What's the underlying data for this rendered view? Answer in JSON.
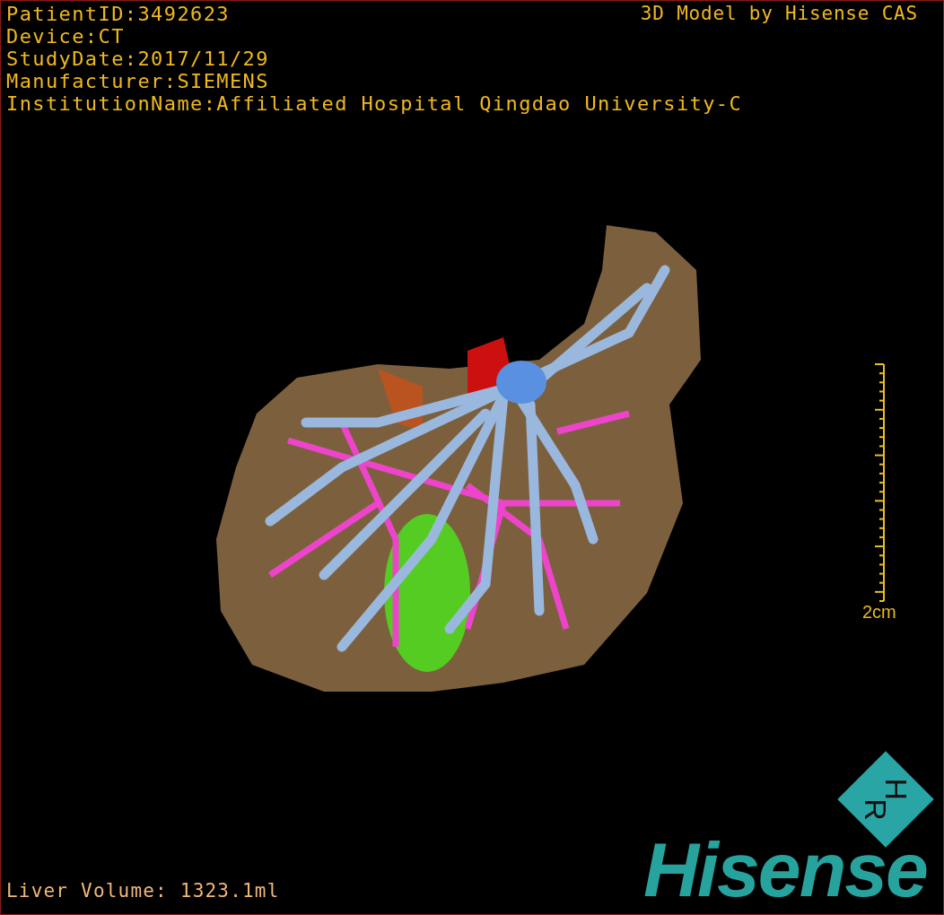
{
  "info_lines": [
    "PatientID:3492623",
    "Device:CT",
    "StudyDate:2017/11/29",
    "Manufacturer:SIEMENS",
    "InstitutionName:Affiliated Hospital Qingdao University-C"
  ],
  "model_credit": "3D Model by Hisense CAS",
  "scale_bar": {
    "label": "2cm"
  },
  "liver_volume": "Liver Volume: 1323.1ml",
  "logo": {
    "badge_letters": [
      "H",
      "R"
    ],
    "wordmark": "Hisense"
  }
}
